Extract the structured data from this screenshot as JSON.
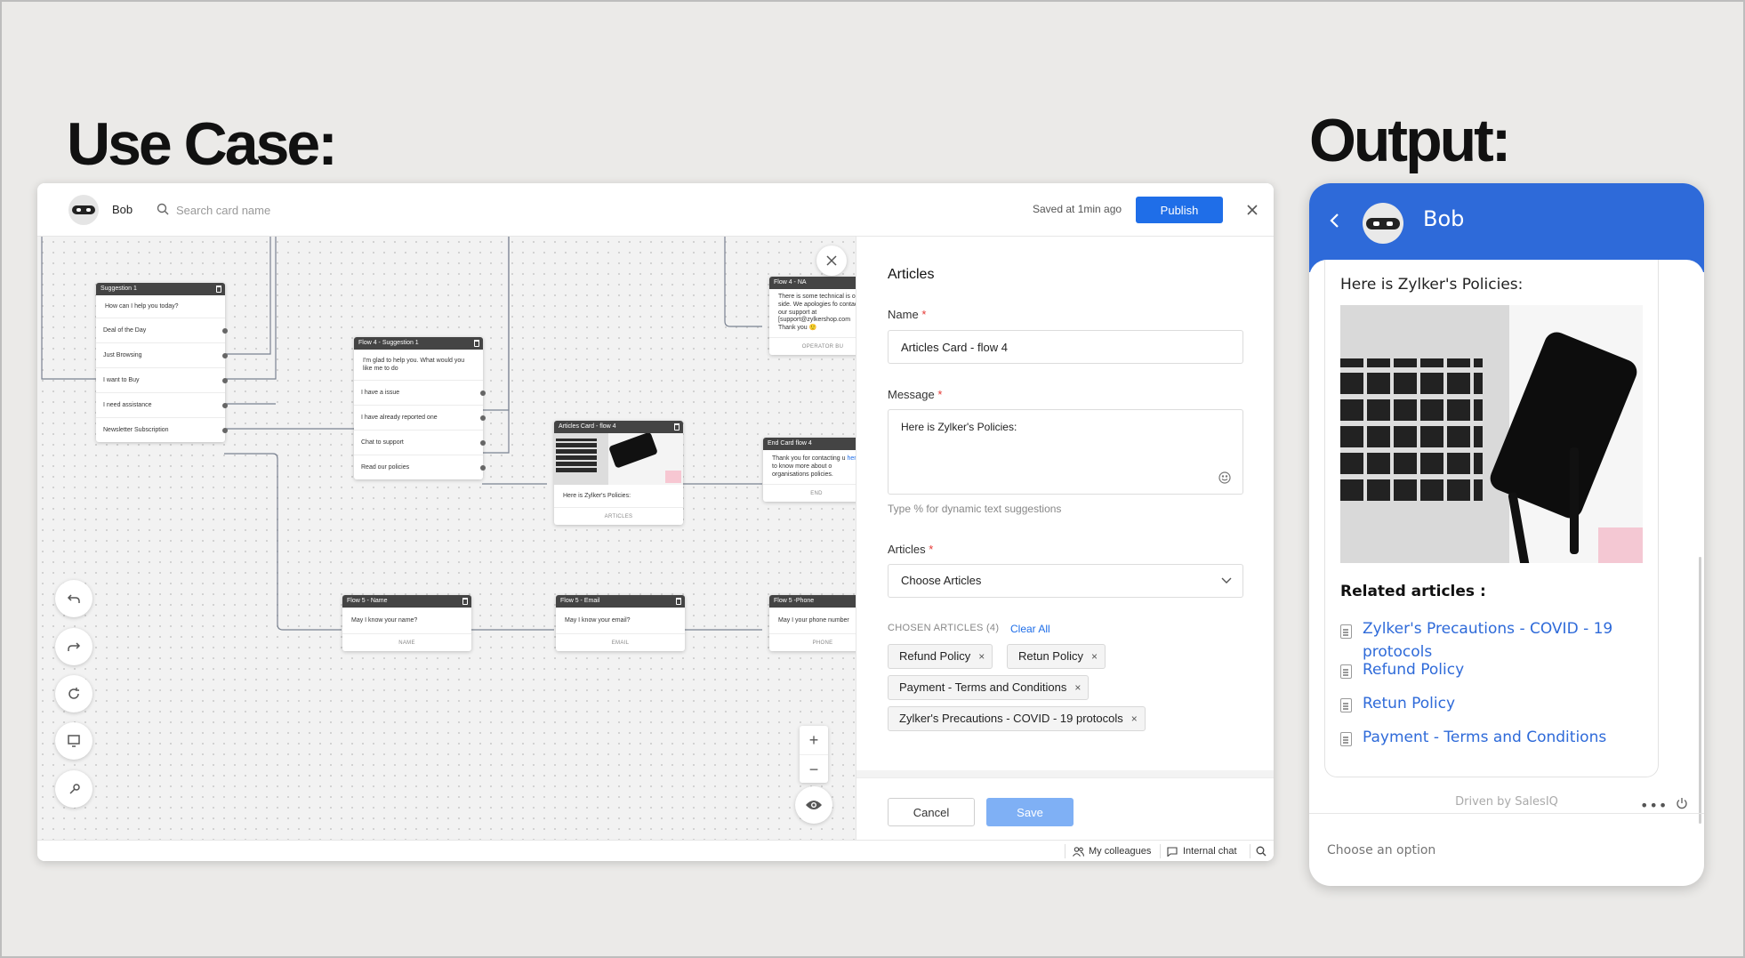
{
  "headings": {
    "use_case": "Use Case:",
    "output": "Output:"
  },
  "builder": {
    "bot_name": "Bob",
    "search_placeholder": "Search card name",
    "saved_status": "Saved at 1min ago",
    "publish_label": "Publish",
    "cards": {
      "suggestion1": {
        "title": "Suggestion 1",
        "message": "How can I help you today?",
        "options": [
          "Deal of the Day",
          "Just Browsing",
          "I want to Buy",
          "I need assistance",
          "Newsletter Subscription"
        ]
      },
      "flow4_suggestion1": {
        "title": "Flow 4 - Suggestion 1",
        "message": "I'm glad to help you. What would you like me to do",
        "options": [
          "I have a issue",
          "I have already reported one",
          "Chat to support",
          "Read our policies"
        ]
      },
      "articles_card": {
        "title": "Articles Card - flow 4",
        "message": "Here is Zylker's Policies:",
        "footer": "ARTICLES"
      },
      "flow4_na": {
        "title": "Flow 4 - NA",
        "message": "There is some technical is out side. We apologies fo contact our support at [support@zylkershop.com Thank you 🙂",
        "footer": "OPERATOR BU"
      },
      "end_card": {
        "title": "End Card flow 4",
        "message_a": "Thank you for contacting u",
        "message_link": "here",
        "message_b": " to know more about o organisations policies.",
        "footer": "END"
      },
      "flow5_name": {
        "title": "Flow 5 - Name",
        "message": "May I know your name?",
        "footer": "NAME"
      },
      "flow5_email": {
        "title": "Flow 5 - Email",
        "message": "May I know your email?",
        "footer": "EMAIL"
      },
      "flow5_phone": {
        "title": "Flow 5 -Phone",
        "message": "May I your phone number",
        "footer": "PHONE"
      }
    },
    "zoom": {
      "plus": "+",
      "minus": "−"
    },
    "panel": {
      "title": "Articles",
      "name_label": "Name",
      "name_value": "Articles Card - flow 4",
      "message_label": "Message",
      "message_value": "Here is Zylker's Policies:",
      "hint": "Type % for dynamic text suggestions",
      "articles_label": "Articles",
      "articles_select": "Choose Articles",
      "chosen_label": "CHOSEN ARTICLES (4)",
      "clear_all": "Clear All",
      "chips": [
        "Refund Policy",
        "Retun Policy",
        "Payment - Terms and Conditions",
        "Zylker's Precautions - COVID - 19 protocols"
      ],
      "required_mark": "*",
      "chip_remove": "×",
      "cancel_label": "Cancel",
      "save_label": "Save"
    },
    "statusbar": {
      "colleagues": "My colleagues",
      "internal_chat": "Internal chat"
    }
  },
  "widget": {
    "bot_name": "Bob",
    "message": "Here is Zylker's Policies:",
    "related_title": "Related articles :",
    "links": [
      "Zylker's Precautions - COVID - 19 protocols",
      "Refund Policy",
      "Retun Policy",
      "Payment - Terms and Conditions"
    ],
    "driven_by": "Driven by SalesIQ",
    "more": "•••",
    "input_placeholder": "Choose an option"
  },
  "colors": {
    "accent": "#1f6ee8",
    "widget_header": "#2e6ad9",
    "save_disabled": "#7fb0f5",
    "required": "#e53935"
  }
}
